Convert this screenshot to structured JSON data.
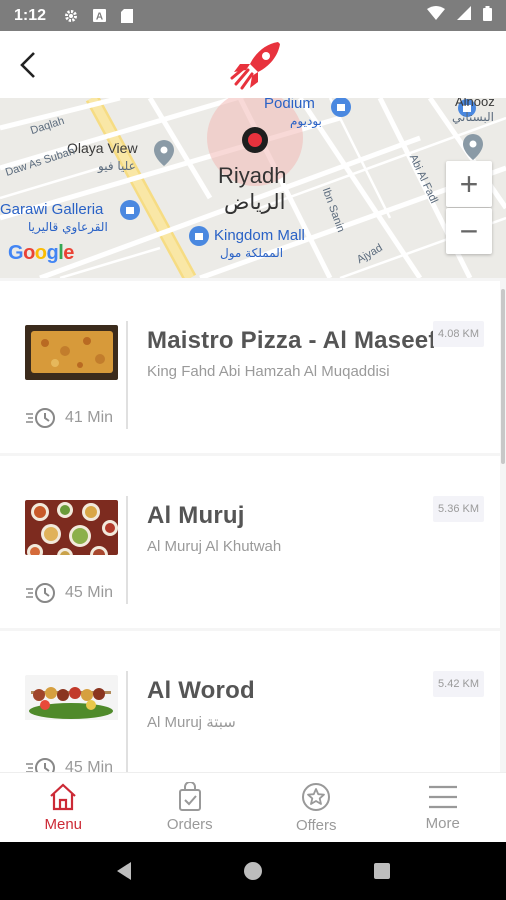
{
  "status_bar": {
    "time": "1:12",
    "icons": [
      "gear-icon",
      "a-icon",
      "sd-card-icon",
      "wifi-icon",
      "signal-icon",
      "battery-icon"
    ]
  },
  "header": {
    "back_icon": "back-arrow-icon",
    "logo": "rocket-logo-icon",
    "accent_color": "#cc2a36"
  },
  "map": {
    "city": "Riyadh",
    "city_ar": "الرياض",
    "places": [
      {
        "name": "Podium",
        "name_ar": "بوديوم"
      },
      {
        "name": "Olaya View",
        "name_ar": "عليا فيو"
      },
      {
        "name": "Garawi Galleria",
        "name_ar": "القرعاوي قاليريا"
      },
      {
        "name": "Kingdom Mall",
        "name_ar": "المملكة مول"
      },
      {
        "name": "Alnooz",
        "name_ar": "البستاني"
      }
    ],
    "streets": [
      "Daqlah",
      "Daw As Subah",
      "Ibn Sanin",
      "Ajyad",
      "Abi Al Fadl"
    ],
    "zoom_in": "+",
    "zoom_out": "−",
    "attribution": [
      "G",
      "o",
      "o",
      "g",
      "l",
      "e"
    ]
  },
  "restaurants": [
    {
      "name": "Maistro Pizza - Al Maseef",
      "address": "King Fahd  Abi Hamzah Al Muqaddisi",
      "distance": "4.08  KM",
      "time": "41  Min"
    },
    {
      "name": "Al Muruj",
      "address": "Al Muruj  Al Khutwah",
      "distance": "5.36  KM",
      "time": "45  Min"
    },
    {
      "name": "Al Worod",
      "address": "Al Muruj  سبتة",
      "distance": "5.42  KM",
      "time": "45  Min"
    }
  ],
  "bottom_nav": {
    "items": [
      {
        "label": "Menu",
        "icon": "home-icon",
        "active": true
      },
      {
        "label": "Orders",
        "icon": "orders-bag-icon",
        "active": false
      },
      {
        "label": "Offers",
        "icon": "offers-star-icon",
        "active": false
      },
      {
        "label": "More",
        "icon": "hamburger-menu-icon",
        "active": false
      }
    ]
  }
}
